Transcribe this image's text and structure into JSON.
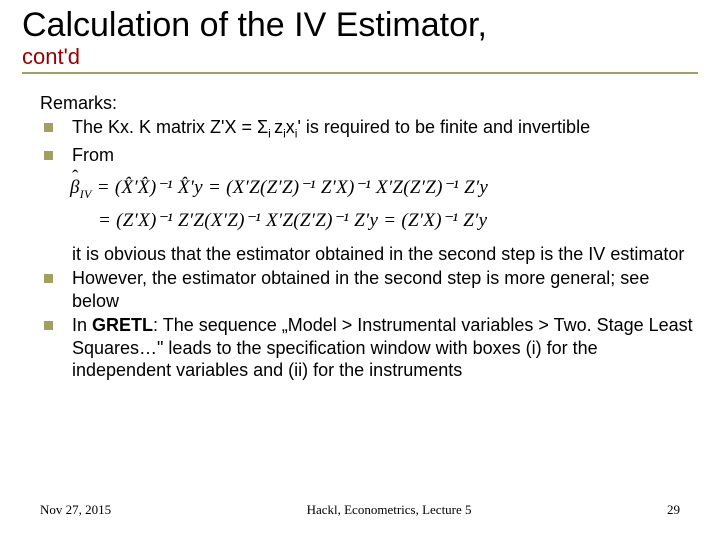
{
  "title": {
    "main": "Calculation of the IV Estimator,",
    "sub": "cont'd"
  },
  "remarks_label": "Remarks:",
  "bullets": {
    "b1_pre": "The Kx. K matrix Z'X = Σ",
    "b1_sub1": "i ",
    "b1_mid1": "z",
    "b1_sub2": "i",
    "b1_mid2": "x",
    "b1_sub3": "i",
    "b1_post": "' is required to be finite and invertible",
    "b2": "From",
    "obvious": "it is obvious that the estimator obtained in the second step is the IV estimator",
    "b3": "However, the estimator obtained in the second step is more general; see below",
    "b4_pre": "In ",
    "b4_bold": "GRETL",
    "b4_post": ": The sequence „Model > Instrumental variables > Two. Stage Least Squares…\" leads to the specification window with boxes (i) for the independent variables and (ii) for the instruments"
  },
  "equations": {
    "line1_lhs_sub": "IV",
    "line1": " = (X̂′X̂)⁻¹ X̂′y = (X′Z(Z′Z)⁻¹ Z′X)⁻¹ X′Z(Z′Z)⁻¹ Z′y",
    "line2": "= (Z′X)⁻¹ Z′Z(X′Z)⁻¹ X′Z(Z′Z)⁻¹ Z′y = (Z′X)⁻¹ Z′y"
  },
  "footer": {
    "date": "Nov 27, 2015",
    "center": "Hackl,  Econometrics, Lecture 5",
    "page": "29"
  }
}
